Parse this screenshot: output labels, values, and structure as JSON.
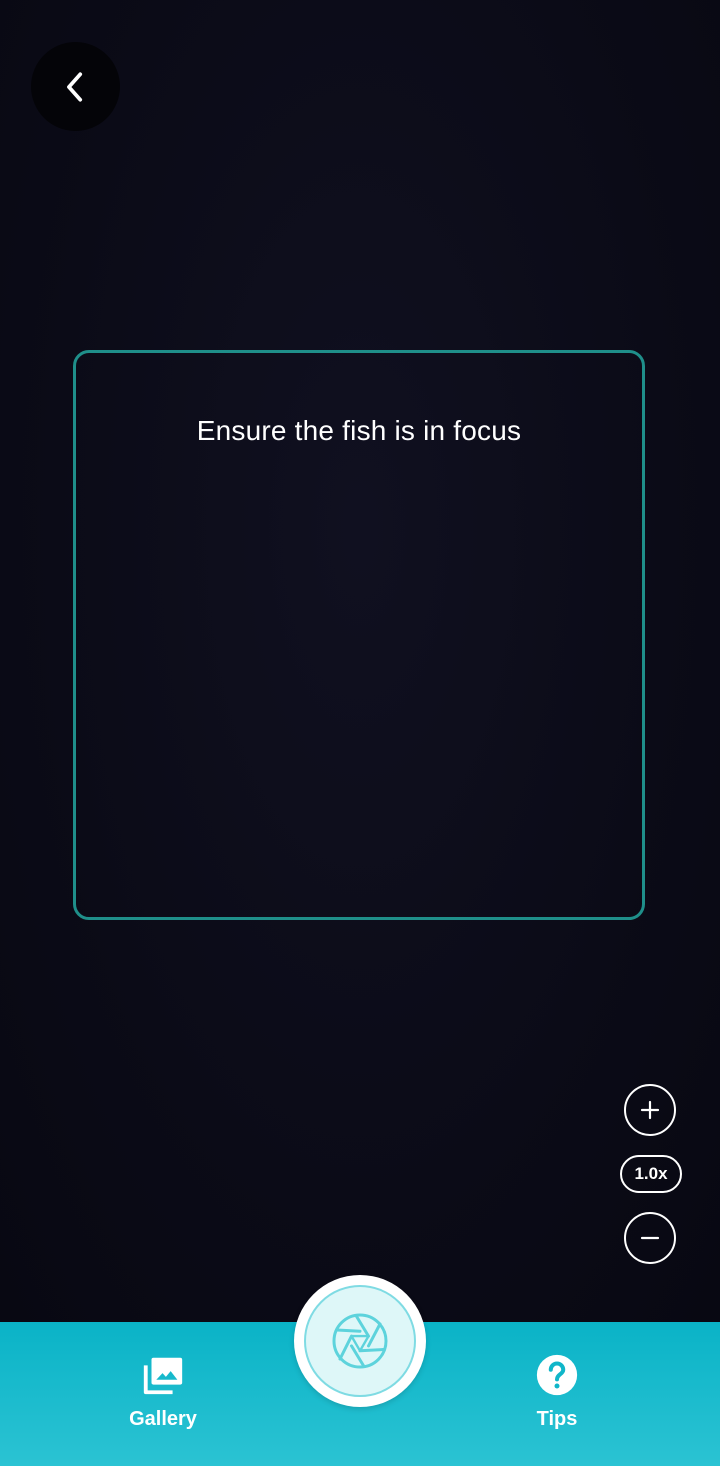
{
  "header": {
    "back_icon": "chevron-left-icon"
  },
  "viewfinder": {
    "hint": "Ensure the fish is in focus",
    "frame_color": "#1f8f8a"
  },
  "zoom": {
    "in_icon": "plus-icon",
    "level": "1.0x",
    "out_icon": "minus-icon"
  },
  "bottom_bar": {
    "background": "#0ab3c7",
    "gallery": {
      "label": "Gallery",
      "icon": "photo-library-icon"
    },
    "shutter": {
      "icon": "camera-aperture-icon",
      "accent": "#5dd3dc"
    },
    "tips": {
      "label": "Tips",
      "icon": "help-circle-icon"
    }
  }
}
